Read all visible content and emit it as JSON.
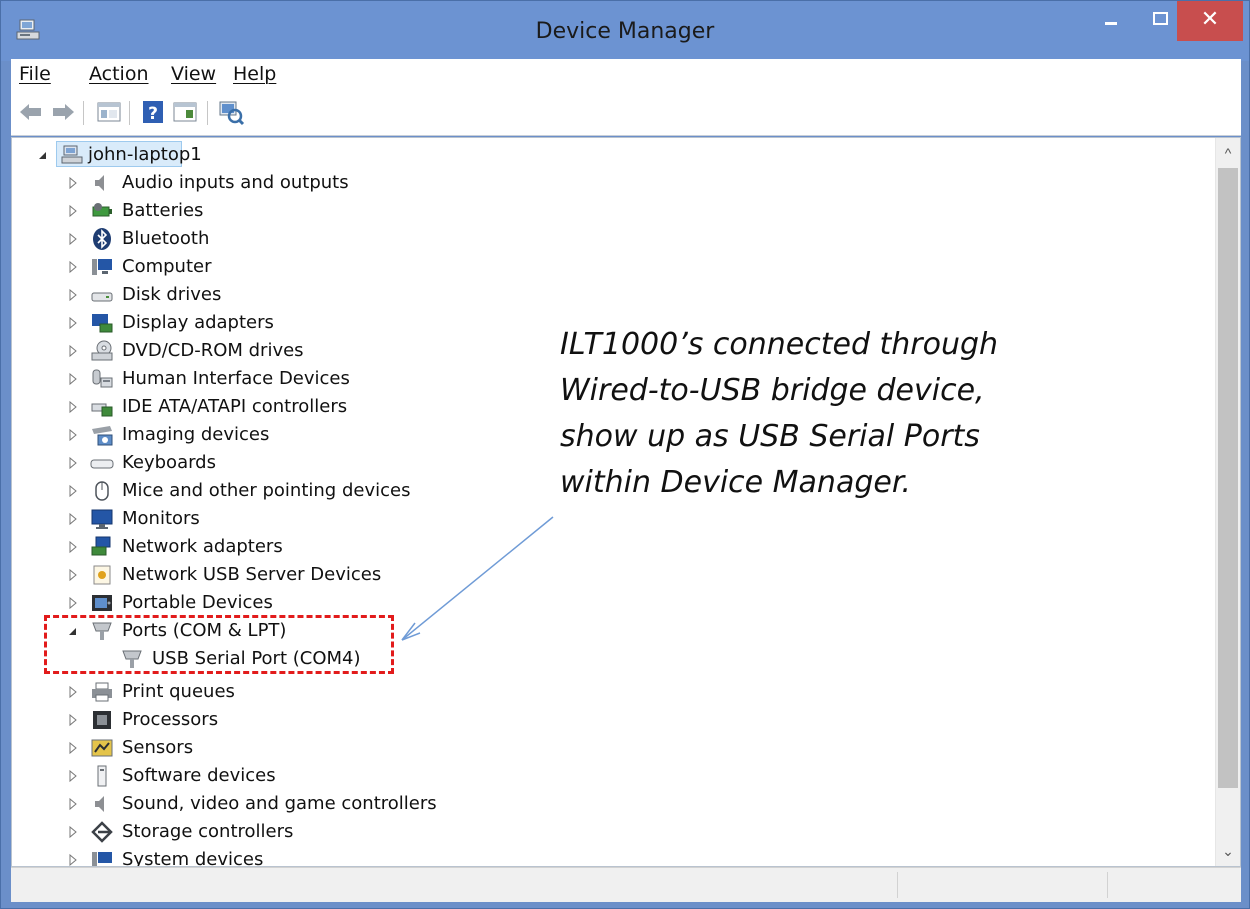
{
  "window": {
    "title": "Device Manager",
    "close_symbol": "✕",
    "accent_color": "#6c93d2",
    "close_color": "#c84e4e"
  },
  "menu": {
    "items": [
      "File",
      "Action",
      "View",
      "Help"
    ]
  },
  "toolbar": {
    "icons": [
      "back-icon",
      "forward-icon",
      "show-hide-tree-icon",
      "help-icon",
      "properties-icon",
      "scan-hardware-icon"
    ]
  },
  "tree": {
    "root": {
      "label": "john-laptop1",
      "expanded": true,
      "icon": "computer-icon"
    },
    "items": [
      {
        "label": "Audio inputs and outputs",
        "icon": "speaker-icon",
        "expanded": false
      },
      {
        "label": "Batteries",
        "icon": "battery-icon",
        "expanded": false
      },
      {
        "label": "Bluetooth",
        "icon": "bluetooth-icon",
        "expanded": false
      },
      {
        "label": "Computer",
        "icon": "computer-monitor-icon",
        "expanded": false
      },
      {
        "label": "Disk drives",
        "icon": "disk-drive-icon",
        "expanded": false
      },
      {
        "label": "Display adapters",
        "icon": "display-adapter-icon",
        "expanded": false
      },
      {
        "label": "DVD/CD-ROM drives",
        "icon": "dvd-drive-icon",
        "expanded": false
      },
      {
        "label": "Human Interface Devices",
        "icon": "hid-icon",
        "expanded": false
      },
      {
        "label": "IDE ATA/ATAPI controllers",
        "icon": "ide-controller-icon",
        "expanded": false
      },
      {
        "label": "Imaging devices",
        "icon": "camera-icon",
        "expanded": false
      },
      {
        "label": "Keyboards",
        "icon": "keyboard-icon",
        "expanded": false
      },
      {
        "label": "Mice and other pointing devices",
        "icon": "mouse-icon",
        "expanded": false
      },
      {
        "label": "Monitors",
        "icon": "monitor-icon",
        "expanded": false
      },
      {
        "label": "Network adapters",
        "icon": "network-adapter-icon",
        "expanded": false
      },
      {
        "label": "Network USB Server Devices",
        "icon": "usb-server-icon",
        "expanded": false
      },
      {
        "label": "Portable Devices",
        "icon": "portable-device-icon",
        "expanded": false
      },
      {
        "label": "Ports (COM & LPT)",
        "icon": "port-icon",
        "expanded": true,
        "children": [
          {
            "label": "USB Serial Port (COM4)",
            "icon": "port-icon"
          }
        ]
      },
      {
        "label": "Print queues",
        "icon": "printer-icon",
        "expanded": false
      },
      {
        "label": "Processors",
        "icon": "processor-icon",
        "expanded": false
      },
      {
        "label": "Sensors",
        "icon": "sensor-icon",
        "expanded": false
      },
      {
        "label": "Software devices",
        "icon": "software-device-icon",
        "expanded": false
      },
      {
        "label": "Sound, video and game controllers",
        "icon": "speaker-icon",
        "expanded": false
      },
      {
        "label": "Storage controllers",
        "icon": "storage-controller-icon",
        "expanded": false
      },
      {
        "label": "System devices",
        "icon": "system-device-icon",
        "expanded": false
      }
    ]
  },
  "annotation": {
    "lines": [
      "ILT1000’s connected through",
      "Wired-to-USB bridge device,",
      "show up as USB Serial Ports",
      "within Device Manager."
    ],
    "highlight_color": "#e21b1b",
    "arrow_color": "#6f9bd6"
  }
}
